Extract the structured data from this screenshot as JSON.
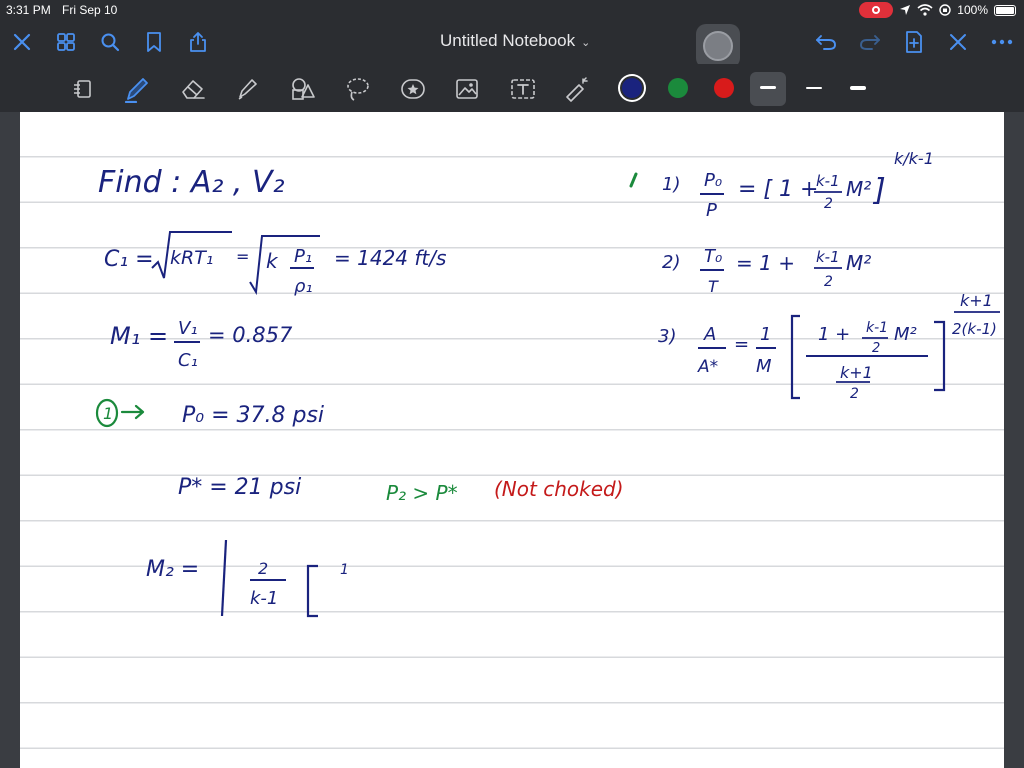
{
  "status_bar": {
    "time": "3:31 PM",
    "date": "Fri Sep 10",
    "battery": "100%"
  },
  "title_bar": {
    "title": "Untitled Notebook",
    "left_icons": [
      "close-icon",
      "grid-icon",
      "search-icon",
      "bookmark-icon",
      "share-icon"
    ],
    "right_icons": [
      "undo-icon",
      "redo-icon",
      "add-page-icon",
      "close-pen-icon",
      "more-icon"
    ]
  },
  "toolbar": {
    "tools": [
      "page-view-icon",
      "pen-icon",
      "eraser-icon",
      "highlighter-icon",
      "shapes-icon",
      "lasso-icon",
      "sticker-icon",
      "image-icon",
      "text-icon",
      "laser-icon"
    ],
    "colors": [
      "#1a237e",
      "#1b8a3c",
      "#d81b1b"
    ],
    "selected_color": "#1a237e"
  },
  "notes": {
    "find": "Find : A₂ , V₂",
    "c1_left": "C₁ =",
    "c1_sqrt1": "kRT₁",
    "c1_eq": "=",
    "c1_k": "k",
    "c1_num": "P₁",
    "c1_den": "ρ₁",
    "c1_value": "= 1424 ft/s",
    "m1_left": "M₁ =",
    "m1_num": "V₁",
    "m1_den": "C₁",
    "m1_value": "= 0.857",
    "circle1": "1",
    "p0_line": "P₀ = 37.8 psi",
    "pstar_line": "P* = 21 psi",
    "green_compare": "P₂ > P*",
    "red_note": "(Not choked)",
    "m2_left": "M₂ =",
    "m2_num": "2",
    "m2_den": "k-1",
    "m2_one": "1",
    "eq1_label": "1)",
    "eq1_num": "P₀",
    "eq1_den": "P",
    "eq1_rhs": "= [ 1 + ",
    "eq1_frac_num": "k-1",
    "eq1_frac_den": "2",
    "eq1_m2": "M²",
    "eq1_close": "]",
    "eq1_exp": "k/k-1",
    "eq2_label": "2)",
    "eq2_num": "T₀",
    "eq2_den": "T",
    "eq2_rhs": "= 1 +",
    "eq2_frac_num": "k-1",
    "eq2_frac_den": "2",
    "eq2_m2": "M²",
    "eq3_label": "3)",
    "eq3_num": "A",
    "eq3_den": "A*",
    "eq3_eq": "=",
    "eq3_one": "1",
    "eq3_m": "M",
    "eq3_inner_top": "1 +",
    "eq3_inner_frac_num": "k-1",
    "eq3_inner_frac_den": "2",
    "eq3_inner_m2": "M²",
    "eq3_inner_bot_num": "k+1",
    "eq3_inner_bot_den": "2",
    "eq3_exp_num": "k+1",
    "eq3_exp_den": "2(k-1)"
  }
}
